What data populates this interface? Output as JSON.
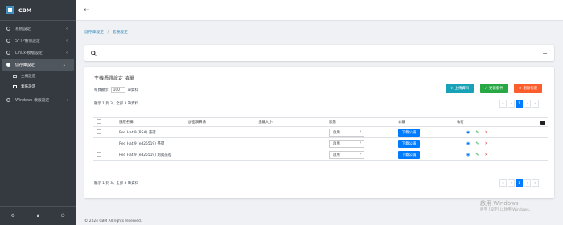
{
  "app": {
    "name": "CBM"
  },
  "sidebar": {
    "items": [
      {
        "label": "系統設定",
        "chevron": "‹"
      },
      {
        "label": "SFTP備份設定",
        "chevron": "‹"
      },
      {
        "label": "Linux-模版設定",
        "chevron": "‹"
      },
      {
        "label": "儲存庫設定",
        "chevron": "⌄"
      }
    ],
    "subitems": [
      {
        "label": "主機設定"
      },
      {
        "label": "套裝設定"
      }
    ],
    "windows": {
      "label": "Windows-模版設定",
      "chevron": "‹"
    }
  },
  "breadcrumb": {
    "parent": "儲存庫設定",
    "separator": "/",
    "current": "套裝設定"
  },
  "card": {
    "title": "主機憑證設定 清單",
    "length_prefix": "每頁顯示",
    "length_value": "100",
    "length_suffix": "筆資料",
    "buttons": {
      "upload": "上傳資料",
      "update": "更新套件",
      "delete": "刪除包裹"
    },
    "info_top": "顯示 1 到 3，全部 3 筆資料",
    "info_bottom": "顯示 1 到 3，全部 3 筆資料",
    "pager": {
      "first": "«",
      "prev": "‹",
      "page": "1",
      "next": "›",
      "last": "»"
    },
    "columns": [
      "",
      "憑證名稱",
      "加密演算法",
      "金鑰大小",
      "狀態",
      "公鑰",
      "執行"
    ],
    "rows": [
      {
        "name": "Red Hat 9 (RSA) 憑證",
        "status": "啟用",
        "download": "下載公鑰"
      },
      {
        "name": "Red Hat 9 (ed25519) 憑證",
        "status": "啟用",
        "download": "下載公鑰"
      },
      {
        "name": "Red Hat 9 (ed25519) 測試憑證",
        "status": "啟用",
        "download": "下載公鑰"
      }
    ]
  },
  "footer": {
    "copyright": "© 2024 CBM All rights reserved."
  },
  "watermark": {
    "line1": "啟用 Windows",
    "line2": "移至 [設定] 以啟用 Windows。"
  },
  "colors": {
    "primary": "#007bff",
    "info": "#17a2b8",
    "success": "#28a745",
    "danger": "#fd5d2d",
    "sidebar": "#343a40"
  }
}
